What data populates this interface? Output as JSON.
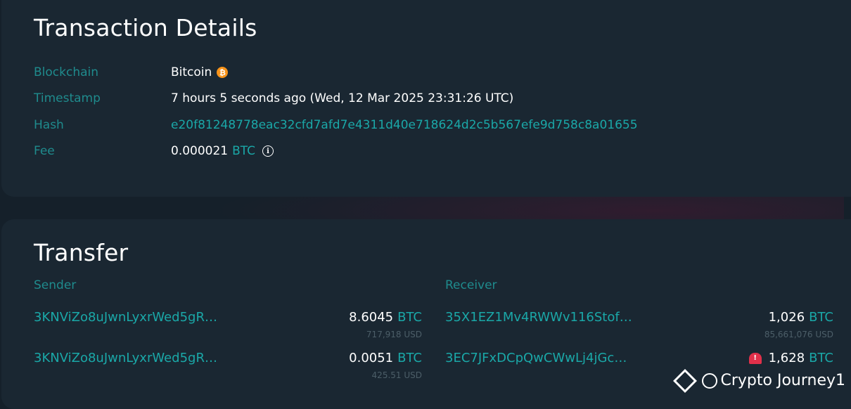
{
  "details": {
    "title": "Transaction Details",
    "rows": [
      {
        "label": "Blockchain",
        "value": "Bitcoin",
        "icon": "bitcoin-icon"
      },
      {
        "label": "Timestamp",
        "value": "7 hours 5 seconds ago (Wed, 12 Mar 2025 23:31:26 UTC)"
      },
      {
        "label": "Hash",
        "value": "e20f81248778eac32cfd7afd7e4311d40e718624d2c5b567efe9d758c8a01655"
      },
      {
        "label": "Fee",
        "value": "0.000021",
        "unit": "BTC",
        "icon": "info-icon"
      }
    ]
  },
  "transfer": {
    "title": "Transfer",
    "sender_header": "Sender",
    "receiver_header": "Receiver",
    "senders": [
      {
        "address": "3KNViZo8uJwnLyxrWed5gR…",
        "amount": "8.6045",
        "unit": "BTC",
        "usd": "717,918 USD"
      },
      {
        "address": "3KNViZo8uJwnLyxrWed5gR…",
        "amount": "0.0051",
        "unit": "BTC",
        "usd": "425.51 USD"
      }
    ],
    "receivers": [
      {
        "address": "35X1EZ1Mv4RWWv116Stof…",
        "amount": "1,026",
        "unit": "BTC",
        "usd": "85,661,076 USD"
      },
      {
        "address": "3EC7JFxDCpQwCWwLj4jGc…",
        "amount": "1,628",
        "unit": "BTC",
        "usd": "",
        "icon": "alert-siren-icon"
      }
    ]
  },
  "watermark": {
    "text": "Crypto Journey1"
  },
  "colors": {
    "accent": "#1aa8a8",
    "label": "#1f8b8d",
    "bitcoin": "#f7931a",
    "background": "#15202a",
    "card": "#1a2732"
  }
}
